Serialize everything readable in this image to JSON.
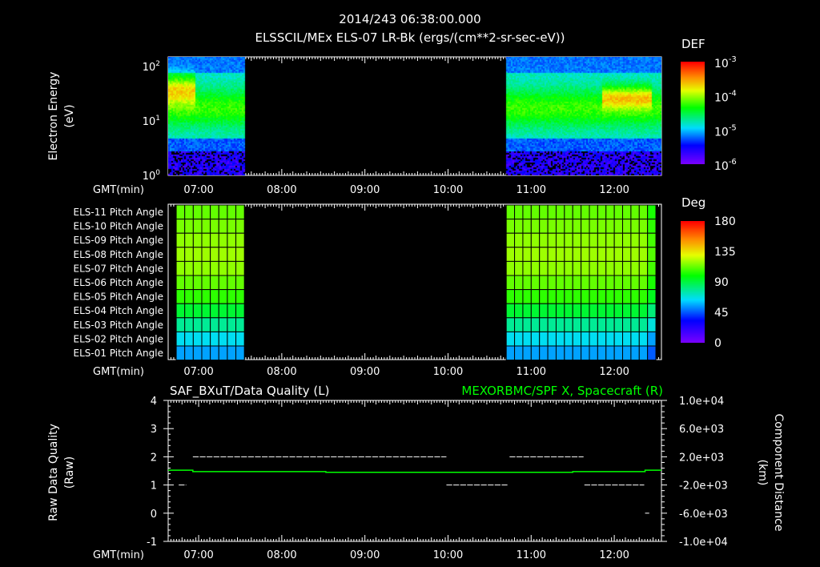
{
  "header": {
    "time": "2014/243 06:38:00.000",
    "title": "ELSSCIL/MEx ELS-07 LR-Bk  (ergs/(cm**2-sr-sec-eV))"
  },
  "gmt_label": "GMT(min)",
  "time_ticks": [
    "07:00",
    "08:00",
    "09:00",
    "10:00",
    "11:00",
    "12:00"
  ],
  "chart_data": [
    {
      "type": "heatmap",
      "name": "energy-spectrogram",
      "ylabel": "Electron Energy",
      "yunit": "(eV)",
      "yscale": "log",
      "ylim": [
        1,
        150
      ],
      "yticks": [
        {
          "b": "10",
          "e": "0"
        },
        {
          "b": "10",
          "e": "1"
        },
        {
          "b": "10",
          "e": "2"
        }
      ],
      "xlim_hours": [
        6.633,
        12.567
      ],
      "data_intervals_hours": [
        [
          6.633,
          7.55
        ],
        [
          10.7,
          12.567
        ]
      ],
      "colorbar": {
        "label": "DEF",
        "scale": "log",
        "range": [
          1e-06,
          0.001
        ],
        "ticks": [
          {
            "b": "10",
            "e": "-3"
          },
          {
            "b": "10",
            "e": "-4"
          },
          {
            "b": "10",
            "e": "-5"
          },
          {
            "b": "10",
            "e": "-6"
          }
        ]
      },
      "features": [
        "peak ~30-50 eV near 06:50 (~3e-4)",
        "peak ~30 eV near 12:10 (~2e-4)",
        "low flux below 3 eV"
      ]
    },
    {
      "type": "heatmap",
      "name": "pitch-angle",
      "rows": [
        "ELS-11 Pitch Angle",
        "ELS-10 Pitch Angle",
        "ELS-09 Pitch Angle",
        "ELS-08 Pitch Angle",
        "ELS-07 Pitch Angle",
        "ELS-06 Pitch Angle",
        "ELS-05 Pitch Angle",
        "ELS-04 Pitch Angle",
        "ELS-03 Pitch Angle",
        "ELS-02 Pitch Angle",
        "ELS-01 Pitch Angle"
      ],
      "row_values_deg": [
        112,
        115,
        118,
        120,
        118,
        112,
        105,
        92,
        78,
        65,
        55
      ],
      "data_intervals_hours": [
        [
          6.73,
          7.55
        ],
        [
          10.7,
          12.5
        ]
      ],
      "colorbar": {
        "label": "Deg",
        "range": [
          0,
          180
        ],
        "ticks": [
          "180",
          "135",
          "90",
          "45",
          "0"
        ]
      }
    },
    {
      "type": "line",
      "name": "quality-and-position",
      "title_left": "SAF_BXuT/Data Quality (L)",
      "title_right": "MEXORBMC/SPF X, Spacecraft (R)",
      "ylabel_left": "Raw Data Quality",
      "yunit_left": "(Raw)",
      "ylim_left": [
        -1,
        4
      ],
      "yticks_left": [
        "4",
        "3",
        "2",
        "1",
        "0",
        "-1"
      ],
      "ylabel_right": "Component Distance",
      "yunit_right": "(km)",
      "ylim_right": [
        -10000,
        10000
      ],
      "yticks_right": [
        "1.0e+04",
        "6.0e+03",
        "2.0e+03",
        "-2.0e+03",
        "-6.0e+03",
        "-1.0e+04"
      ],
      "series": [
        {
          "name": "Data Quality",
          "color": "#ffffff",
          "segments": [
            [
              6.76,
              6.85,
              1
            ],
            [
              6.93,
              9.98,
              2
            ],
            [
              9.98,
              10.72,
              1
            ],
            [
              10.74,
              11.63,
              2
            ],
            [
              11.64,
              12.36,
              1
            ],
            [
              12.37,
              12.42,
              0
            ]
          ]
        },
        {
          "name": "SPF X",
          "color": "#00ff00",
          "points": [
            [
              6.633,
              100
            ],
            [
              6.93,
              100
            ],
            [
              6.93,
              -100
            ],
            [
              8.53,
              -100
            ],
            [
              8.53,
              -200
            ],
            [
              11.5,
              -200
            ],
            [
              11.5,
              -100
            ],
            [
              12.37,
              -100
            ],
            [
              12.37,
              100
            ],
            [
              12.567,
              100
            ]
          ]
        }
      ]
    }
  ]
}
